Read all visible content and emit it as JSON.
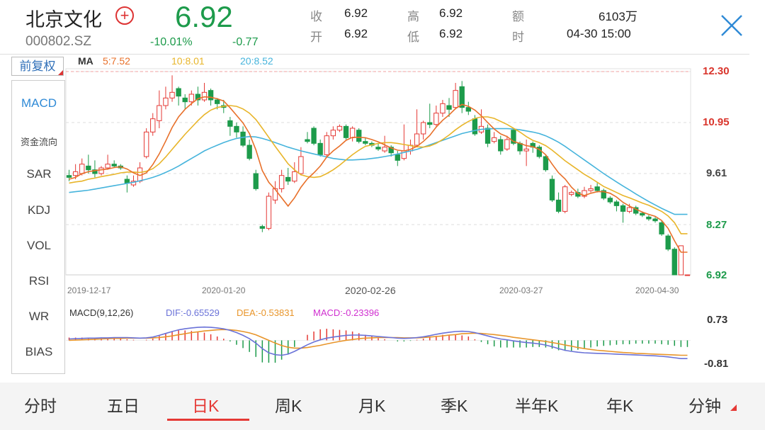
{
  "stock": {
    "name": "北京文化",
    "code": "000802.SZ",
    "price": "6.92",
    "change_pct": "-10.01%",
    "change": "-0.77",
    "add_icon": "plus-circle-icon"
  },
  "quote": {
    "shou_label": "收",
    "shou_value": "6.92",
    "kai_label": "开",
    "kai_value": "6.92",
    "gao_label": "高",
    "gao_value": "6.92",
    "di_label": "低",
    "di_value": "6.92",
    "e_label": "额",
    "e_value": "6103万",
    "shi_label": "时",
    "shi_value": "04-30 15:00"
  },
  "colors": {
    "down": "#1d9b4b",
    "up": "#e53935",
    "ma5": "#e8702a",
    "ma10": "#e8b52a",
    "ma20": "#46b4dc",
    "dif": "#6a72d8",
    "dea": "#e8952a",
    "macd": "#d02fd0"
  },
  "adjust": {
    "label": "前复权"
  },
  "ma": {
    "title": "MA",
    "ma5": "5:7.52",
    "ma10": "10:8.01",
    "ma20": "20:8.52"
  },
  "sidebar": {
    "items": [
      {
        "label": "MACD"
      },
      {
        "label": "资金流向"
      },
      {
        "label": "SAR"
      },
      {
        "label": "KDJ"
      },
      {
        "label": "VOL"
      },
      {
        "label": "RSI"
      },
      {
        "label": "WR"
      },
      {
        "label": "BIAS"
      }
    ]
  },
  "price_axis": [
    "12.30",
    "10.95",
    "9.61",
    "8.27",
    "6.92"
  ],
  "dates": [
    "2019-12-17",
    "2020-01-20",
    "2020-02-26",
    "2020-03-27",
    "2020-04-30"
  ],
  "macd": {
    "title": "MACD(9,12,26)",
    "dif": "DIF:-0.65529",
    "dea": "DEA:-0.53831",
    "macd": "MACD:-0.23396",
    "axis_top": "0.73",
    "axis_bottom": "-0.81"
  },
  "tabs": [
    {
      "label": "分时"
    },
    {
      "label": "五日"
    },
    {
      "label": "日K"
    },
    {
      "label": "周K"
    },
    {
      "label": "月K"
    },
    {
      "label": "季K"
    },
    {
      "label": "半年K"
    },
    {
      "label": "年K"
    },
    {
      "label": "分钟"
    }
  ],
  "active_tab": "日K",
  "chart_data": {
    "type": "candlestick",
    "ylim": [
      6.92,
      12.3
    ],
    "candles": [
      {
        "o": 9.55,
        "c": 9.5,
        "h": 9.7,
        "l": 9.4
      },
      {
        "o": 9.55,
        "c": 9.65,
        "h": 9.85,
        "l": 9.45
      },
      {
        "o": 9.6,
        "c": 9.85,
        "h": 10.0,
        "l": 9.55
      },
      {
        "o": 9.8,
        "c": 9.7,
        "h": 10.1,
        "l": 9.6
      },
      {
        "o": 9.7,
        "c": 9.6,
        "h": 9.95,
        "l": 9.5
      },
      {
        "o": 9.6,
        "c": 9.75,
        "h": 9.8,
        "l": 9.55
      },
      {
        "o": 9.75,
        "c": 9.85,
        "h": 10.1,
        "l": 9.7
      },
      {
        "o": 9.85,
        "c": 9.8,
        "h": 9.95,
        "l": 9.75
      },
      {
        "o": 9.8,
        "c": 9.75,
        "h": 9.85,
        "l": 9.7
      },
      {
        "o": 9.45,
        "c": 9.35,
        "h": 9.55,
        "l": 9.1
      },
      {
        "o": 9.3,
        "c": 9.4,
        "h": 9.55,
        "l": 9.25
      },
      {
        "o": 9.4,
        "c": 9.75,
        "h": 9.9,
        "l": 9.35
      },
      {
        "o": 10.05,
        "c": 10.7,
        "h": 10.8,
        "l": 10.0
      },
      {
        "o": 10.7,
        "c": 11.05,
        "h": 11.2,
        "l": 10.6
      },
      {
        "o": 11.0,
        "c": 11.4,
        "h": 11.8,
        "l": 10.8
      },
      {
        "o": 11.4,
        "c": 11.6,
        "h": 11.9,
        "l": 11.3
      },
      {
        "o": 11.6,
        "c": 11.75,
        "h": 12.2,
        "l": 11.5
      },
      {
        "o": 11.85,
        "c": 11.65,
        "h": 11.9,
        "l": 11.4
      },
      {
        "o": 11.6,
        "c": 11.5,
        "h": 11.7,
        "l": 11.3
      },
      {
        "o": 11.5,
        "c": 11.7,
        "h": 11.8,
        "l": 11.4
      },
      {
        "o": 11.7,
        "c": 11.55,
        "h": 11.9,
        "l": 11.4
      },
      {
        "o": 11.55,
        "c": 11.75,
        "h": 12.0,
        "l": 11.5
      },
      {
        "o": 11.8,
        "c": 11.55,
        "h": 11.85,
        "l": 11.4
      },
      {
        "o": 11.55,
        "c": 11.45,
        "h": 11.6,
        "l": 11.3
      },
      {
        "o": 11.4,
        "c": 11.35,
        "h": 11.55,
        "l": 11.2
      },
      {
        "o": 11.0,
        "c": 10.85,
        "h": 11.1,
        "l": 10.6
      },
      {
        "o": 10.85,
        "c": 10.7,
        "h": 10.95,
        "l": 10.55
      },
      {
        "o": 10.7,
        "c": 10.35,
        "h": 10.85,
        "l": 10.3
      },
      {
        "o": 10.35,
        "c": 10.0,
        "h": 10.5,
        "l": 9.95
      },
      {
        "o": 9.6,
        "c": 9.2,
        "h": 9.7,
        "l": 9.15
      },
      {
        "o": 8.2,
        "c": 8.15,
        "h": 8.25,
        "l": 8.05
      },
      {
        "o": 8.15,
        "c": 9.0,
        "h": 9.1,
        "l": 8.1
      },
      {
        "o": 8.9,
        "c": 9.2,
        "h": 9.4,
        "l": 8.8
      },
      {
        "o": 9.2,
        "c": 9.55,
        "h": 9.7,
        "l": 9.1
      },
      {
        "o": 9.5,
        "c": 9.4,
        "h": 9.75,
        "l": 9.3
      },
      {
        "o": 9.4,
        "c": 9.65,
        "h": 9.9,
        "l": 9.35
      },
      {
        "o": 9.6,
        "c": 10.05,
        "h": 10.3,
        "l": 9.55
      },
      {
        "o": 10.5,
        "c": 10.45,
        "h": 10.7,
        "l": 10.4
      },
      {
        "o": 10.8,
        "c": 10.4,
        "h": 10.85,
        "l": 10.35
      },
      {
        "o": 10.4,
        "c": 10.1,
        "h": 10.5,
        "l": 10.05
      },
      {
        "o": 10.1,
        "c": 10.6,
        "h": 10.7,
        "l": 10.05
      },
      {
        "o": 10.6,
        "c": 10.75,
        "h": 10.85,
        "l": 10.5
      },
      {
        "o": 10.75,
        "c": 10.85,
        "h": 10.9,
        "l": 10.7
      },
      {
        "o": 10.85,
        "c": 10.55,
        "h": 10.9,
        "l": 10.5
      },
      {
        "o": 10.55,
        "c": 10.8,
        "h": 10.85,
        "l": 10.45
      },
      {
        "o": 10.75,
        "c": 10.45,
        "h": 10.8,
        "l": 10.4
      },
      {
        "o": 10.45,
        "c": 10.4,
        "h": 10.55,
        "l": 10.35
      },
      {
        "o": 10.4,
        "c": 10.35,
        "h": 10.45,
        "l": 10.3
      },
      {
        "o": 10.3,
        "c": 10.25,
        "h": 10.4,
        "l": 10.2
      },
      {
        "o": 10.2,
        "c": 10.3,
        "h": 10.6,
        "l": 10.15
      },
      {
        "o": 10.3,
        "c": 10.15,
        "h": 10.35,
        "l": 10.05
      },
      {
        "o": 10.1,
        "c": 9.95,
        "h": 10.2,
        "l": 9.8
      },
      {
        "o": 10.0,
        "c": 10.2,
        "h": 10.9,
        "l": 9.95
      },
      {
        "o": 10.2,
        "c": 10.35,
        "h": 10.5,
        "l": 10.1
      },
      {
        "o": 10.35,
        "c": 10.65,
        "h": 11.3,
        "l": 10.3
      },
      {
        "o": 10.65,
        "c": 10.95,
        "h": 11.0,
        "l": 10.5
      },
      {
        "o": 10.95,
        "c": 10.9,
        "h": 11.45,
        "l": 10.8
      },
      {
        "o": 10.9,
        "c": 11.2,
        "h": 11.4,
        "l": 10.85
      },
      {
        "o": 11.2,
        "c": 11.45,
        "h": 11.55,
        "l": 11.1
      },
      {
        "o": 11.4,
        "c": 11.3,
        "h": 11.6,
        "l": 11.1
      },
      {
        "o": 11.35,
        "c": 11.8,
        "h": 12.0,
        "l": 11.3
      },
      {
        "o": 11.9,
        "c": 11.35,
        "h": 12.05,
        "l": 11.2
      },
      {
        "o": 11.35,
        "c": 11.25,
        "h": 11.5,
        "l": 11.15
      },
      {
        "o": 11.05,
        "c": 10.65,
        "h": 11.15,
        "l": 10.6
      },
      {
        "o": 10.7,
        "c": 10.85,
        "h": 11.3,
        "l": 10.65
      },
      {
        "o": 10.8,
        "c": 10.4,
        "h": 10.9,
        "l": 10.3
      },
      {
        "o": 10.45,
        "c": 10.55,
        "h": 10.7,
        "l": 10.4
      },
      {
        "o": 10.5,
        "c": 10.2,
        "h": 10.6,
        "l": 10.1
      },
      {
        "o": 10.25,
        "c": 10.5,
        "h": 10.6,
        "l": 10.2
      },
      {
        "o": 10.75,
        "c": 10.4,
        "h": 10.8,
        "l": 10.35
      },
      {
        "o": 10.4,
        "c": 10.2,
        "h": 10.45,
        "l": 10.1
      },
      {
        "o": 10.2,
        "c": 10.25,
        "h": 10.5,
        "l": 9.8
      },
      {
        "o": 10.4,
        "c": 10.3,
        "h": 10.45,
        "l": 10.15
      },
      {
        "o": 10.3,
        "c": 10.05,
        "h": 10.35,
        "l": 10.0
      },
      {
        "o": 10.05,
        "c": 9.7,
        "h": 10.1,
        "l": 9.65
      },
      {
        "o": 9.45,
        "c": 8.9,
        "h": 9.55,
        "l": 8.85
      },
      {
        "o": 8.9,
        "c": 8.6,
        "h": 9.1,
        "l": 8.55
      },
      {
        "o": 8.6,
        "c": 9.25,
        "h": 9.3,
        "l": 8.55
      },
      {
        "o": 9.05,
        "c": 9.1,
        "h": 9.15,
        "l": 9.0
      },
      {
        "o": 9.1,
        "c": 9.0,
        "h": 9.2,
        "l": 8.95
      },
      {
        "o": 9.0,
        "c": 9.15,
        "h": 9.25,
        "l": 8.95
      },
      {
        "o": 9.15,
        "c": 9.2,
        "h": 9.3,
        "l": 9.1
      },
      {
        "o": 9.25,
        "c": 9.15,
        "h": 9.35,
        "l": 9.1
      },
      {
        "o": 9.15,
        "c": 8.95,
        "h": 9.2,
        "l": 8.9
      },
      {
        "o": 8.95,
        "c": 8.85,
        "h": 9.0,
        "l": 8.8
      },
      {
        "o": 8.85,
        "c": 8.75,
        "h": 8.9,
        "l": 8.6
      },
      {
        "o": 8.75,
        "c": 8.6,
        "h": 8.8,
        "l": 8.3
      },
      {
        "o": 8.6,
        "c": 8.7,
        "h": 8.8,
        "l": 8.55
      },
      {
        "o": 8.7,
        "c": 8.55,
        "h": 8.75,
        "l": 8.5
      },
      {
        "o": 8.55,
        "c": 8.5,
        "h": 8.6,
        "l": 8.45
      },
      {
        "o": 8.45,
        "c": 8.4,
        "h": 8.5,
        "l": 8.35
      },
      {
        "o": 8.4,
        "c": 8.35,
        "h": 8.45,
        "l": 8.3
      },
      {
        "o": 8.3,
        "c": 8.0,
        "h": 8.35,
        "l": 7.95
      },
      {
        "o": 7.95,
        "c": 7.6,
        "h": 8.0,
        "l": 7.55
      },
      {
        "o": 7.6,
        "c": 6.92,
        "h": 7.65,
        "l": 6.92
      },
      {
        "o": 6.92,
        "c": 7.69,
        "h": 7.7,
        "l": 6.92
      },
      {
        "o": 6.92,
        "c": 6.92,
        "h": 6.92,
        "l": 6.92
      }
    ],
    "ma5": [
      9.45,
      9.5,
      9.6,
      9.65,
      9.68,
      9.7,
      9.72,
      9.76,
      9.78,
      9.72,
      9.62,
      9.55,
      9.62,
      9.84,
      10.12,
      10.46,
      10.82,
      11.1,
      11.3,
      11.45,
      11.58,
      11.63,
      11.62,
      11.58,
      11.52,
      11.34,
      11.14,
      10.94,
      10.66,
      10.23,
      9.68,
      9.37,
      9.18,
      8.96,
      8.74,
      8.96,
      9.24,
      9.46,
      9.62,
      9.8,
      10.04,
      10.2,
      10.33,
      10.48,
      10.56,
      10.56,
      10.55,
      10.5,
      10.44,
      10.36,
      10.28,
      10.22,
      10.2,
      10.24,
      10.32,
      10.45,
      10.61,
      10.83,
      11.01,
      11.15,
      11.32,
      11.43,
      11.38,
      11.28,
      11.13,
      10.95,
      10.78,
      10.65,
      10.58,
      10.45,
      10.4,
      10.34,
      10.31,
      10.24,
      10.1,
      9.85,
      9.62,
      9.46,
      9.24,
      9.08,
      9.02,
      9.08,
      9.12,
      9.12,
      9.08,
      8.98,
      8.84,
      8.74,
      8.66,
      8.58,
      8.52,
      8.47,
      8.36,
      8.15,
      7.82,
      7.52,
      7.52
    ],
    "ma10": [
      9.35,
      9.38,
      9.4,
      9.45,
      9.48,
      9.52,
      9.55,
      9.58,
      9.62,
      9.64,
      9.64,
      9.63,
      9.66,
      9.73,
      9.86,
      10.04,
      10.24,
      10.44,
      10.64,
      10.82,
      11.0,
      11.16,
      11.28,
      11.35,
      11.38,
      11.4,
      11.38,
      11.31,
      11.2,
      11.03,
      10.8,
      10.56,
      10.32,
      10.09,
      9.86,
      9.7,
      9.57,
      9.52,
      9.5,
      9.52,
      9.6,
      9.7,
      9.82,
      9.96,
      10.1,
      10.22,
      10.32,
      10.36,
      10.4,
      10.42,
      10.42,
      10.4,
      10.37,
      10.34,
      10.31,
      10.3,
      10.33,
      10.4,
      10.5,
      10.62,
      10.76,
      10.88,
      10.98,
      11.06,
      11.1,
      11.1,
      11.06,
      10.98,
      10.9,
      10.8,
      10.7,
      10.58,
      10.48,
      10.42,
      10.34,
      10.22,
      10.08,
      9.94,
      9.82,
      9.7,
      9.58,
      9.48,
      9.37,
      9.26,
      9.18,
      9.1,
      9.02,
      8.96,
      8.89,
      8.82,
      8.76,
      8.68,
      8.6,
      8.48,
      8.3,
      8.01,
      8.01
    ],
    "ma20": [
      9.1,
      9.12,
      9.14,
      9.16,
      9.19,
      9.22,
      9.25,
      9.28,
      9.31,
      9.34,
      9.37,
      9.41,
      9.45,
      9.5,
      9.56,
      9.63,
      9.71,
      9.8,
      9.9,
      10.0,
      10.1,
      10.2,
      10.28,
      10.35,
      10.42,
      10.48,
      10.53,
      10.56,
      10.58,
      10.57,
      10.53,
      10.48,
      10.42,
      10.36,
      10.3,
      10.25,
      10.2,
      10.16,
      10.12,
      10.08,
      10.04,
      10.0,
      9.98,
      9.96,
      9.96,
      9.97,
      9.98,
      10.0,
      10.02,
      10.05,
      10.08,
      10.12,
      10.16,
      10.2,
      10.24,
      10.3,
      10.36,
      10.42,
      10.48,
      10.54,
      10.6,
      10.66,
      10.7,
      10.74,
      10.77,
      10.78,
      10.79,
      10.79,
      10.79,
      10.78,
      10.76,
      10.73,
      10.7,
      10.66,
      10.6,
      10.52,
      10.43,
      10.32,
      10.2,
      10.08,
      9.96,
      9.84,
      9.72,
      9.6,
      9.49,
      9.38,
      9.27,
      9.17,
      9.06,
      8.96,
      8.86,
      8.77,
      8.68,
      8.6,
      8.52,
      8.52,
      8.52
    ],
    "macd_panel": {
      "ylim": [
        -0.81,
        0.73
      ],
      "dif": [
        0.05,
        0.06,
        0.07,
        0.08,
        0.08,
        0.09,
        0.09,
        0.1,
        0.1,
        0.1,
        0.09,
        0.08,
        0.09,
        0.12,
        0.18,
        0.25,
        0.32,
        0.38,
        0.42,
        0.45,
        0.47,
        0.48,
        0.47,
        0.45,
        0.42,
        0.36,
        0.28,
        0.18,
        0.06,
        -0.1,
        -0.3,
        -0.45,
        -0.52,
        -0.54,
        -0.5,
        -0.4,
        -0.28,
        -0.16,
        -0.06,
        0.02,
        0.08,
        0.12,
        0.15,
        0.18,
        0.19,
        0.19,
        0.18,
        0.16,
        0.14,
        0.12,
        0.1,
        0.08,
        0.07,
        0.08,
        0.1,
        0.13,
        0.17,
        0.22,
        0.26,
        0.29,
        0.32,
        0.33,
        0.32,
        0.28,
        0.22,
        0.16,
        0.1,
        0.05,
        0.02,
        -0.02,
        -0.05,
        -0.08,
        -0.1,
        -0.13,
        -0.17,
        -0.23,
        -0.3,
        -0.36,
        -0.4,
        -0.43,
        -0.45,
        -0.46,
        -0.47,
        -0.48,
        -0.49,
        -0.5,
        -0.51,
        -0.52,
        -0.53,
        -0.54,
        -0.55,
        -0.56,
        -0.58,
        -0.6,
        -0.63,
        -0.66,
        -0.66
      ],
      "dea": [
        0.0,
        0.01,
        0.02,
        0.03,
        0.04,
        0.05,
        0.06,
        0.07,
        0.07,
        0.08,
        0.08,
        0.08,
        0.08,
        0.09,
        0.1,
        0.13,
        0.16,
        0.2,
        0.24,
        0.28,
        0.31,
        0.34,
        0.36,
        0.38,
        0.39,
        0.38,
        0.36,
        0.32,
        0.27,
        0.2,
        0.1,
        0.0,
        -0.1,
        -0.19,
        -0.25,
        -0.28,
        -0.28,
        -0.26,
        -0.22,
        -0.18,
        -0.13,
        -0.08,
        -0.04,
        0.0,
        0.03,
        0.06,
        0.08,
        0.09,
        0.1,
        0.1,
        0.1,
        0.1,
        0.09,
        0.09,
        0.09,
        0.1,
        0.12,
        0.14,
        0.16,
        0.19,
        0.21,
        0.24,
        0.25,
        0.26,
        0.25,
        0.23,
        0.21,
        0.18,
        0.15,
        0.11,
        0.08,
        0.05,
        0.02,
        -0.01,
        -0.04,
        -0.08,
        -0.12,
        -0.17,
        -0.21,
        -0.26,
        -0.3,
        -0.33,
        -0.36,
        -0.38,
        -0.4,
        -0.42,
        -0.44,
        -0.45,
        -0.47,
        -0.48,
        -0.49,
        -0.5,
        -0.51,
        -0.52,
        -0.53,
        -0.54,
        -0.54
      ]
    }
  }
}
